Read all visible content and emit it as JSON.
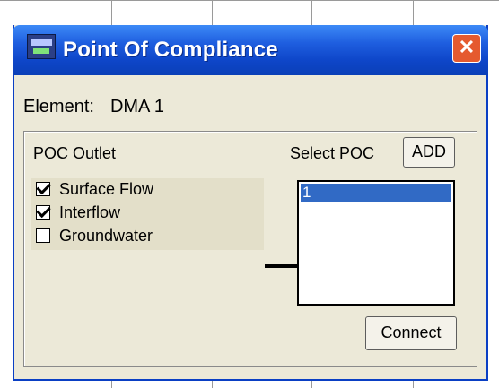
{
  "window": {
    "title": "Point Of Compliance",
    "close_symbol": "✕"
  },
  "element": {
    "label": "Element:",
    "value": "DMA 1"
  },
  "poc_outlet": {
    "label": "POC Outlet",
    "options": [
      {
        "label": "Surface Flow",
        "checked": true
      },
      {
        "label": "Interflow",
        "checked": true
      },
      {
        "label": "Groundwater",
        "checked": false
      }
    ]
  },
  "select_poc": {
    "label": "Select POC",
    "add_label": "ADD",
    "items": [
      "1"
    ],
    "selected_index": 0
  },
  "actions": {
    "connect_label": "Connect"
  },
  "colors": {
    "title_bar": "#0e46c9",
    "dialog_bg": "#ece9d8",
    "selection": "#316ac5"
  }
}
